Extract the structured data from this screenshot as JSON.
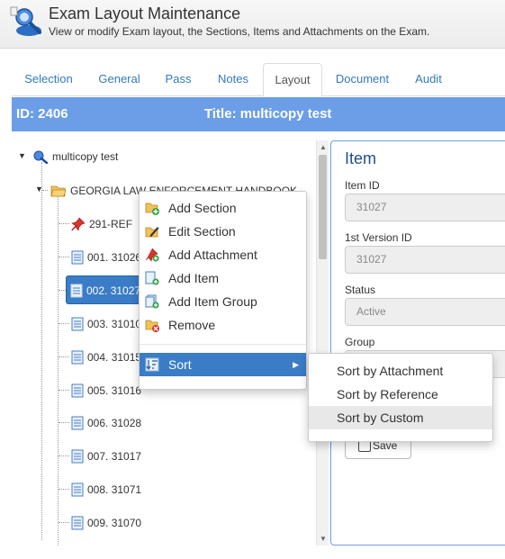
{
  "header": {
    "title": "Exam Layout Maintenance",
    "subtitle": "View or modify Exam layout, the Sections, Items and Attachments on the Exam."
  },
  "tabs": [
    {
      "label": "Selection"
    },
    {
      "label": "General"
    },
    {
      "label": "Pass"
    },
    {
      "label": "Notes"
    },
    {
      "label": "Layout",
      "active": true
    },
    {
      "label": "Document"
    },
    {
      "label": "Audit"
    }
  ],
  "info_bar": {
    "id_text": "ID: 2406",
    "title_text": "Title: multicopy test"
  },
  "tree": {
    "root": {
      "label": "multicopy test",
      "icon": "exam-icon"
    },
    "section": {
      "label": "GEORGIA LAW ENFORCEMENT HANDBOOK",
      "icon": "folder-open-icon"
    },
    "children": [
      {
        "label": "291-REF",
        "icon": "pin-icon"
      },
      {
        "label": "001. 31026",
        "icon": "document-icon"
      },
      {
        "label": "002. 31027",
        "icon": "document-icon",
        "selected": true
      },
      {
        "label": "003. 31010",
        "icon": "document-icon"
      },
      {
        "label": "004. 31015",
        "icon": "document-icon"
      },
      {
        "label": "005. 31016",
        "icon": "document-icon"
      },
      {
        "label": "006. 31028",
        "icon": "document-icon"
      },
      {
        "label": "007. 31017",
        "icon": "document-icon"
      },
      {
        "label": "008. 31071",
        "icon": "document-icon"
      },
      {
        "label": "009. 31070",
        "icon": "document-icon"
      }
    ]
  },
  "item_panel": {
    "heading": "Item",
    "fields": [
      {
        "label": "Item ID",
        "value": "31027"
      },
      {
        "label": "1st Version ID",
        "value": "31027"
      },
      {
        "label": "Status",
        "value": "Active"
      },
      {
        "label": "Group",
        "value": ""
      }
    ],
    "save_label": "Save"
  },
  "context_menu": {
    "items": [
      {
        "label": "Add Section",
        "icon": "add-section-icon"
      },
      {
        "label": "Edit Section",
        "icon": "edit-section-icon"
      },
      {
        "label": "Add Attachment",
        "icon": "add-attachment-icon"
      },
      {
        "label": "Add Item",
        "icon": "add-item-icon"
      },
      {
        "label": "Add Item Group",
        "icon": "add-item-group-icon"
      },
      {
        "label": "Remove",
        "icon": "remove-icon"
      }
    ],
    "sort": {
      "label": "Sort",
      "icon": "sort-icon"
    }
  },
  "sort_submenu": {
    "items": [
      {
        "label": "Sort by Attachment"
      },
      {
        "label": "Sort by Reference"
      },
      {
        "label": "Sort by Custom",
        "hovered": true
      }
    ]
  },
  "colors": {
    "accent": "#6b9ee6",
    "selection": "#3a7cc6",
    "link": "#337ab7"
  }
}
